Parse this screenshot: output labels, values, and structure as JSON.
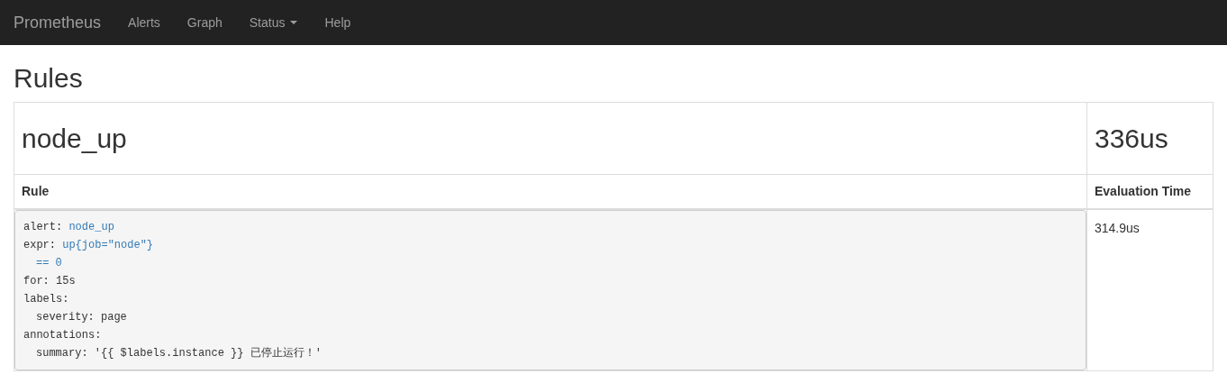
{
  "navbar": {
    "brand": "Prometheus",
    "items": [
      {
        "label": "Alerts",
        "kind": "link"
      },
      {
        "label": "Graph",
        "kind": "link"
      },
      {
        "label": "Status",
        "kind": "dropdown"
      },
      {
        "label": "Help",
        "kind": "link"
      }
    ]
  },
  "page_title": "Rules",
  "groups": [
    {
      "name": "node_up",
      "time": "336us",
      "columns": [
        "Rule",
        "Evaluation Time"
      ],
      "rules": [
        {
          "evaluation_time": "314.9us",
          "lines": [
            {
              "key": "alert:",
              "value": "node_up",
              "kind": "expression"
            },
            {
              "key": "expr:",
              "value": "up{job=\"node\"}",
              "kind": "expression",
              "children": [
                {
                  "value": "== 0",
                  "kind": "expression"
                }
              ]
            },
            {
              "key": "for:",
              "value": "15s",
              "kind": "plain"
            },
            {
              "key": "labels:",
              "children": [
                {
                  "key": "severity:",
                  "value": "page",
                  "kind": "plain"
                }
              ]
            },
            {
              "key": "annotations:",
              "children": [
                {
                  "key": "summary:",
                  "value": "'{{ $labels.instance }} 已停止运行！'",
                  "kind": "plain"
                }
              ]
            }
          ]
        }
      ]
    }
  ]
}
